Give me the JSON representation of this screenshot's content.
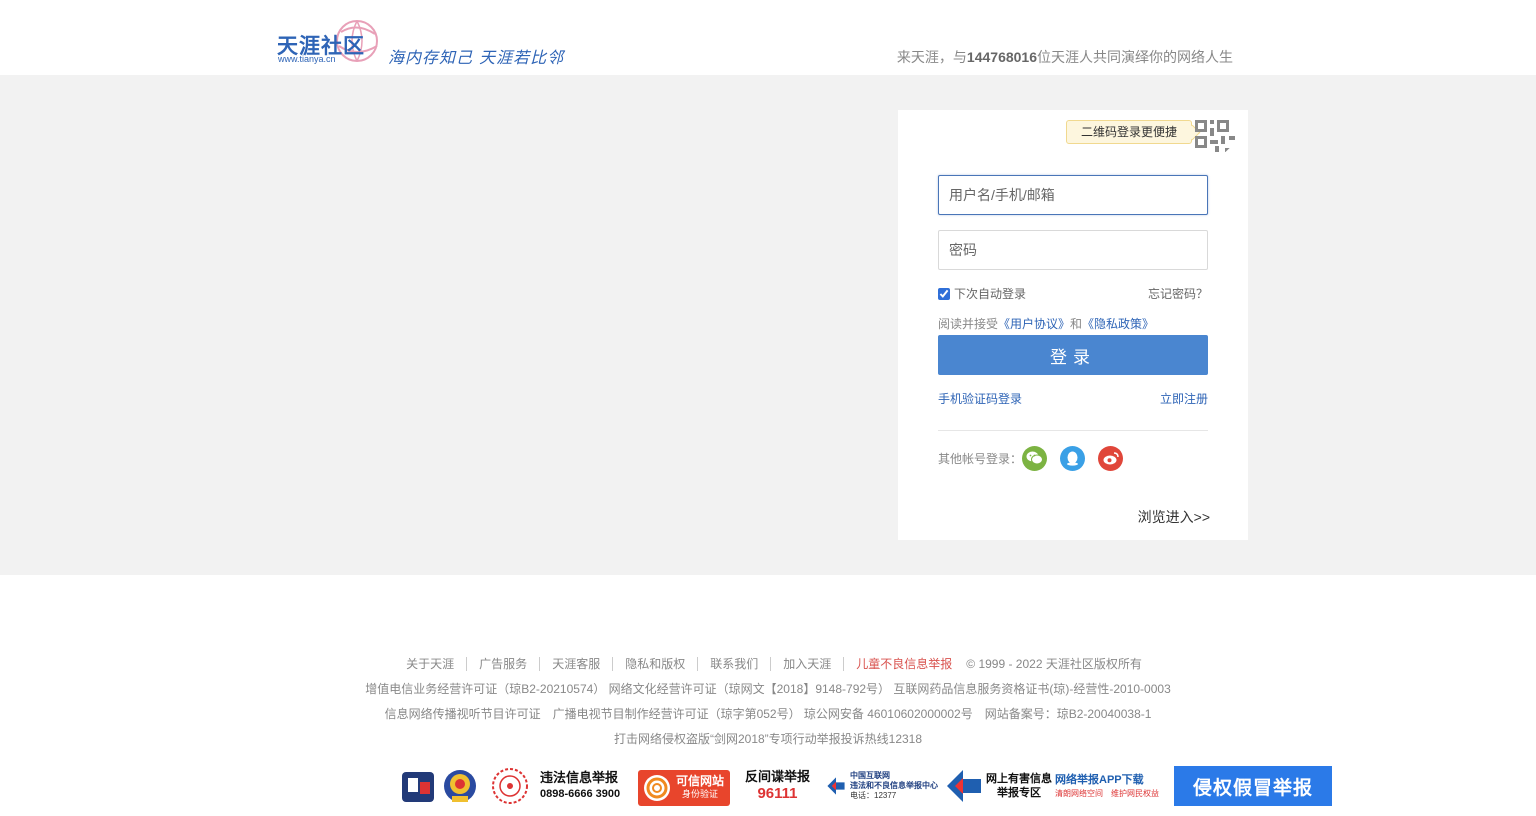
{
  "header": {
    "logo_main": "天涯社区",
    "logo_sub": "www.tianya.cn",
    "slogan": "海内存知己 天涯若比邻",
    "tagline_prefix": "来天涯，与",
    "tagline_count": "144768016",
    "tagline_suffix": "位天涯人共同演绎你的网络人生"
  },
  "login": {
    "qr_tip": "二维码登录更便捷",
    "username_placeholder": "用户名/手机/邮箱",
    "password_placeholder": "密码",
    "remember_label": "下次自动登录",
    "remember_checked": true,
    "forgot": "忘记密码？",
    "agree_prefix": "阅读并接受",
    "agree_user": "《用户协议》",
    "agree_and": "和",
    "agree_privacy": "《隐私政策》",
    "login_button": "登录",
    "sms_login": "手机验证码登录",
    "register": "立即注册",
    "other_label": "其他帐号登录：",
    "browse": "浏览进入>>"
  },
  "footer": {
    "links": [
      "关于天涯",
      "广告服务",
      "天涯客服",
      "隐私和版权",
      "联系我们",
      "加入天涯",
      "儿童不良信息举报"
    ],
    "copyright": "© 1999 - 2022 天涯社区版权所有",
    "line2": "增值电信业务经营许可证（琼B2-20210574） 网络文化经营许可证（琼网文【2018】9148-792号） 互联网药品信息服务资格证书(琼)-经营性-2010-0003",
    "line3": "信息网络传播视听节目许可证　广播电视节目制作经营许可证（琼字第052号） 琼公网安备 46010602000002号　网站备案号：琼B2-20040038-1",
    "line4": "打击网络侵权盗版“剑网2018”专项行动举报投诉热线12318"
  },
  "badges": {
    "illegal_title": "违法信息举报",
    "illegal_phone": "0898-6666 3900",
    "trust_title": "可信网站",
    "trust_sub": "身份验证",
    "spy_title": "反间谍举报",
    "spy_phone": "96111",
    "cnnic_title": "中国互联网",
    "cnnic_sub": "违法和不良信息举报中心",
    "cnnic_phone": "电话：12377",
    "harm_title": "网上有害信息",
    "harm_sub": "举报专区",
    "app_title": "网络举报APP下载",
    "app_sub": "清朗网络空间　维护网民权益",
    "infringe": "侵权假冒举报"
  },
  "colors": {
    "accent": "#4a86d0",
    "link": "#2e64b6",
    "band": "#f2f2f2",
    "danger": "#d9534f"
  }
}
